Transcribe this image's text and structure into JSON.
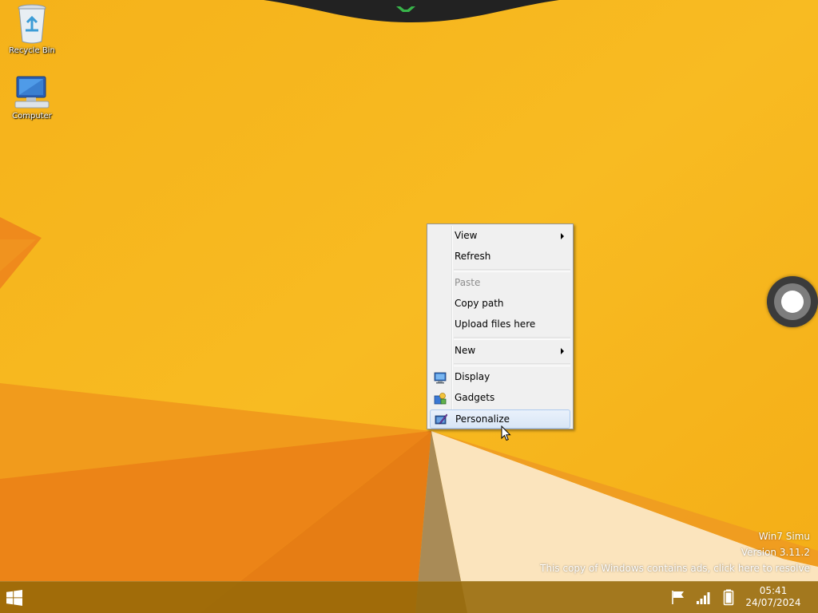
{
  "desktop": {
    "icons": [
      {
        "label": "Recycle Bin",
        "icon": "recycle-bin-icon"
      },
      {
        "label": "Computer",
        "icon": "computer-icon"
      }
    ],
    "wallpaper_color": "#f7b51c"
  },
  "context_menu": {
    "items": [
      {
        "label": "View",
        "submenu": true
      },
      {
        "label": "Refresh"
      },
      {
        "label": "Paste",
        "disabled": true
      },
      {
        "label": "Copy path"
      },
      {
        "label": "Upload files here"
      },
      {
        "label": "New",
        "submenu": true
      },
      {
        "label": "Display",
        "icon": "display-icon"
      },
      {
        "label": "Gadgets",
        "icon": "gadgets-icon"
      },
      {
        "label": "Personalize",
        "icon": "personalize-icon",
        "highlighted": true
      }
    ]
  },
  "watermark": {
    "line1": "Win7 Simu",
    "line2": "Version 3.11.2",
    "line3": "This copy of Windows contains ads, click here to resolve"
  },
  "taskbar": {
    "time": "05:41",
    "date": "24/07/2024",
    "tray_icons": [
      "action-center-flag-icon",
      "signal-bars-icon",
      "battery-icon"
    ],
    "accent_color": "#966908"
  }
}
